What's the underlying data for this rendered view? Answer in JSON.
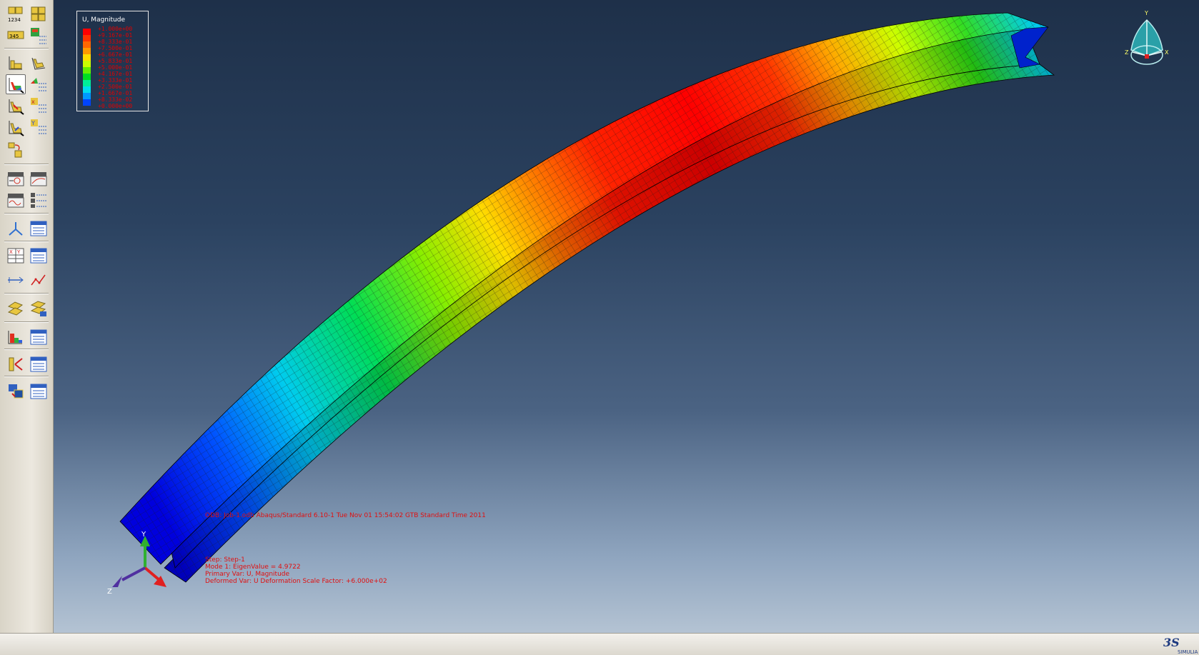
{
  "legend": {
    "title": "U, Magnitude",
    "entries": [
      {
        "label": "+1.000e+00",
        "color": "#ff0000"
      },
      {
        "label": "+9.167e-01",
        "color": "#ff3300"
      },
      {
        "label": "+8.333e-01",
        "color": "#ff6600"
      },
      {
        "label": "+7.500e-01",
        "color": "#ff9900"
      },
      {
        "label": "+6.667e-01",
        "color": "#ffdd00"
      },
      {
        "label": "+5.833e-01",
        "color": "#ccff00"
      },
      {
        "label": "+5.000e-01",
        "color": "#66ee00"
      },
      {
        "label": "+4.167e-01",
        "color": "#00dd22"
      },
      {
        "label": "+3.333e-01",
        "color": "#00ee99"
      },
      {
        "label": "+2.500e-01",
        "color": "#00ddee"
      },
      {
        "label": "+1.667e-01",
        "color": "#0099ff"
      },
      {
        "label": "+8.333e-02",
        "color": "#0044ff"
      },
      {
        "label": "+0.000e+00",
        "color": "#0000dd"
      }
    ]
  },
  "info": {
    "odb_line": "ODB: Job-1.odb    Abaqus/Standard 6.10-1    Tue Nov 01 15:54:02 GTB Standard Time 2011",
    "step_line": "Step: Step-1",
    "mode_line": "Mode    1: EigenValue =   4.9722",
    "primary_line": "Primary Var: U, Magnitude",
    "deformed_line": "Deformed Var: U   Deformation Scale Factor: +6.000e+02"
  },
  "triad": {
    "y": "Y",
    "z": "Z"
  },
  "orientation": {
    "y": "Y",
    "z": "Z",
    "x": "X"
  },
  "colors": {
    "background_top": "#1e3049",
    "background_bottom": "#b4c3d3",
    "annotation_red": "#e01010"
  }
}
